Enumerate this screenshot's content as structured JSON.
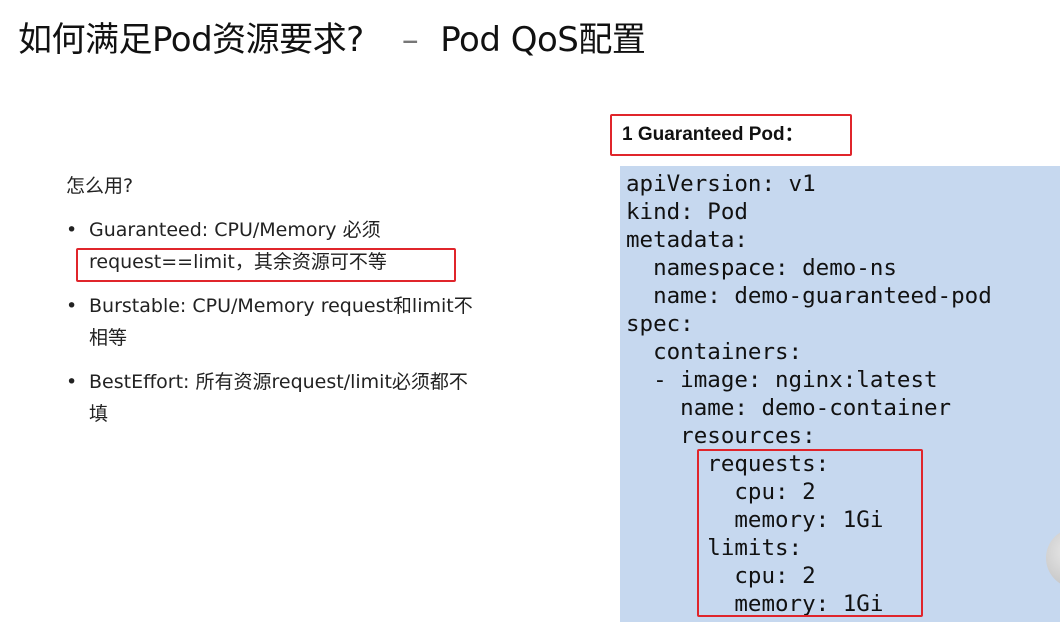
{
  "slide": {
    "title_main": "如何满足Pod资源要求?",
    "title_dash": "–",
    "title_sub": "Pod QoS配置",
    "question": "怎么用?",
    "bullet_symbol": "•",
    "bullets": [
      {
        "line1": "Guaranteed:  CPU/Memory 必须",
        "line2": "request==limit，其余资源可不等"
      },
      {
        "line1": "Burstable:  CPU/Memory request和limit不",
        "line2": "相等"
      },
      {
        "line1": "BestEffort:  所有资源request/limit必须都不",
        "line2": "填"
      }
    ],
    "pod_label": "1 Guaranteed Pod：",
    "code_lines": [
      "apiVersion: v1",
      "kind: Pod",
      "metadata:",
      "  namespace: demo-ns",
      "  name: demo-guaranteed-pod",
      "spec:",
      "  containers:",
      "  - image: nginx:latest",
      "    name: demo-container",
      "    resources:",
      "      requests:",
      "        cpu: 2",
      "        memory: 1Gi",
      "      limits:",
      "        cpu: 2",
      "        memory: 1Gi"
    ],
    "colors": {
      "highlight_border": "#e0252b",
      "code_background": "#c6d8ef",
      "text": "#222222"
    }
  }
}
